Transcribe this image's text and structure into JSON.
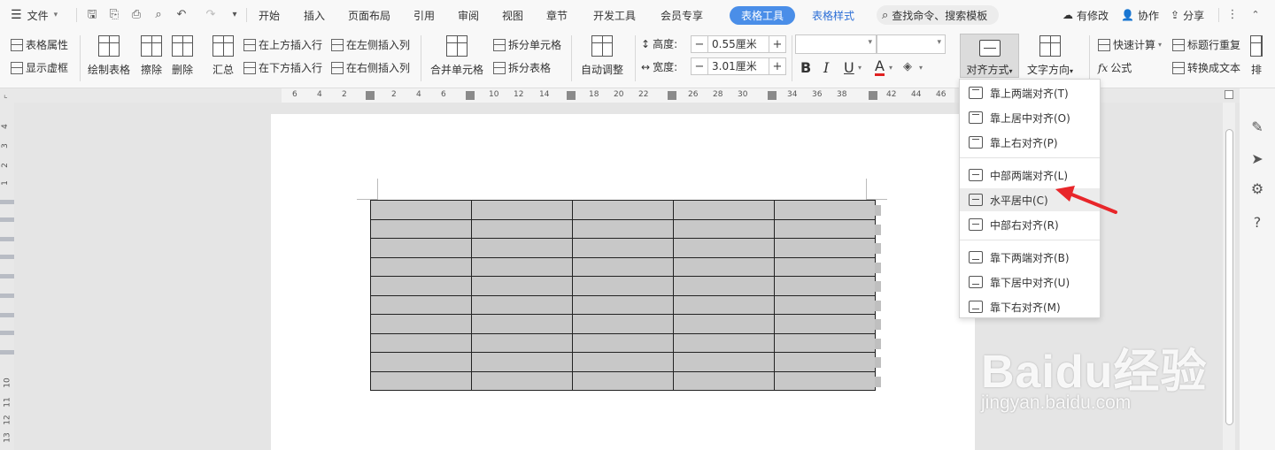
{
  "menubar": {
    "file": "文件",
    "tabs": [
      "开始",
      "插入",
      "页面布局",
      "引用",
      "审阅",
      "视图",
      "章节",
      "开发工具",
      "会员专享"
    ],
    "active_tab": "表格工具",
    "style_tab": "表格样式",
    "search_placeholder": "查找命令、搜索模板",
    "modified": "有修改",
    "collaborate": "协作",
    "share": "分享"
  },
  "ribbon": {
    "table_props": "表格属性",
    "show_gridlines": "显示虚框",
    "draw_table": "绘制表格",
    "erase": "擦除",
    "delete": "删除",
    "summary": "汇总",
    "insert_row_above": "在上方插入行",
    "insert_row_below": "在下方插入行",
    "insert_col_left": "在左侧插入列",
    "insert_col_right": "在右侧插入列",
    "merge_cells": "合并单元格",
    "split_cells": "拆分单元格",
    "split_table": "拆分表格",
    "auto_fit": "自动调整",
    "height_label": "高度:",
    "height_value": "0.55厘米",
    "width_label": "宽度:",
    "width_value": "3.01厘米",
    "bold": "B",
    "italic": "I",
    "underline": "U",
    "font_color": "A",
    "align": "对齐方式",
    "text_direction": "文字方向",
    "quick_calc": "快速计算",
    "formula": "公式",
    "repeat_header": "标题行重复",
    "convert_text": "转换成文本",
    "sort": "排"
  },
  "ruler": {
    "top": [
      "6",
      "4",
      "2",
      "2",
      "4",
      "6",
      "8",
      "10",
      "12",
      "14",
      "18",
      "20",
      "22",
      "26",
      "28",
      "30",
      "34",
      "36",
      "38",
      "42",
      "44",
      "46"
    ],
    "left": [
      "4",
      "3",
      "2",
      "1",
      "10",
      "11",
      "12",
      "13"
    ]
  },
  "align_menu": {
    "items": [
      {
        "label": "靠上两端对齐(T)",
        "pos": "top"
      },
      {
        "label": "靠上居中对齐(O)",
        "pos": "top"
      },
      {
        "label": "靠上右对齐(P)",
        "pos": "top"
      },
      {
        "label": "中部两端对齐(L)",
        "pos": "mid"
      },
      {
        "label": "水平居中(C)",
        "pos": "mid"
      },
      {
        "label": "中部右对齐(R)",
        "pos": "mid"
      },
      {
        "label": "靠下两端对齐(B)",
        "pos": "bot"
      },
      {
        "label": "靠下居中对齐(U)",
        "pos": "bot"
      },
      {
        "label": "靠下右对齐(M)",
        "pos": "bot"
      }
    ],
    "highlighted": 4
  },
  "table": {
    "rows": 10,
    "cols": 5
  },
  "watermark": {
    "brand": "Baidu经验",
    "url": "jingyan.baidu.com"
  },
  "colors": {
    "accent": "#4a8ee8",
    "arrow": "#e8262a",
    "cell": "#c8c8c8"
  }
}
